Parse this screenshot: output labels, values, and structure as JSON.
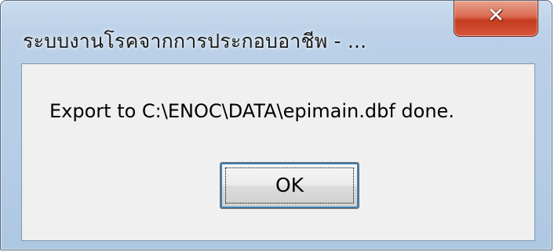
{
  "window": {
    "title": "ระบบงานโรคจากการประกอบอาชีพ - ...",
    "close_icon": "close-icon"
  },
  "dialog": {
    "message": "Export to C:\\ENOC\\DATA\\epimain.dbf done.",
    "ok_label": "OK"
  },
  "colors": {
    "frame": "#b8cfe7",
    "client": "#f0f0f0",
    "close_button": "#c43b1f",
    "focus_ring": "#3c7fb1"
  }
}
